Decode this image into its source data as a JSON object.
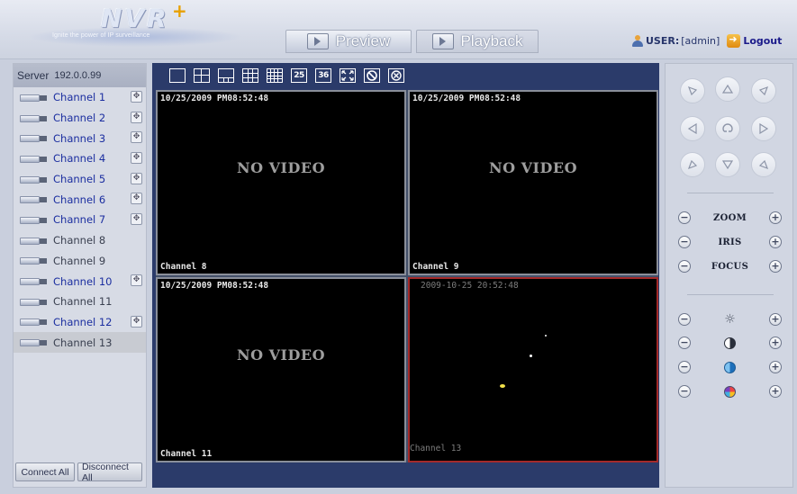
{
  "header": {
    "logo": "NVR",
    "logo_plus": "+",
    "tagline": "Ignite the power of IP surveillance",
    "tabs": [
      {
        "label": "Preview",
        "icon": "monitor-icon"
      },
      {
        "label": "Playback",
        "icon": "play-icon"
      }
    ],
    "user_label": "USER:",
    "user_name": "[admin]",
    "logout_label": "Logout"
  },
  "sidebar": {
    "server_label": "Server",
    "server_ip": "192.0.0.99",
    "channels": [
      {
        "label": "Channel 1",
        "online": true,
        "ptz": true
      },
      {
        "label": "Channel 2",
        "online": true,
        "ptz": true
      },
      {
        "label": "Channel 3",
        "online": true,
        "ptz": true
      },
      {
        "label": "Channel 4",
        "online": true,
        "ptz": true
      },
      {
        "label": "Channel 5",
        "online": true,
        "ptz": true
      },
      {
        "label": "Channel 6",
        "online": true,
        "ptz": true
      },
      {
        "label": "Channel 7",
        "online": true,
        "ptz": true
      },
      {
        "label": "Channel 8",
        "online": false,
        "ptz": false
      },
      {
        "label": "Channel 9",
        "online": false,
        "ptz": false
      },
      {
        "label": "Channel 10",
        "online": true,
        "ptz": true
      },
      {
        "label": "Channel 11",
        "online": false,
        "ptz": false
      },
      {
        "label": "Channel 12",
        "online": true,
        "ptz": true
      },
      {
        "label": "Channel 13",
        "online": false,
        "ptz": false,
        "selected": true
      }
    ],
    "connect_all_label": "Connect All",
    "disconnect_all_label": "Disconnect All"
  },
  "toolbar": {
    "layouts": [
      {
        "name": "layout-1-button",
        "icon": "layout-1-icon"
      },
      {
        "name": "layout-4-button",
        "icon": "layout-4-icon"
      },
      {
        "name": "layout-6-button",
        "icon": "layout-6-icon"
      },
      {
        "name": "layout-9-button",
        "icon": "layout-9-icon"
      },
      {
        "name": "layout-16-button",
        "icon": "layout-16-icon"
      },
      {
        "name": "layout-25-button",
        "label": "25"
      },
      {
        "name": "layout-36-button",
        "label": "36"
      },
      {
        "name": "fullscreen-button",
        "icon": "fullscreen-icon"
      },
      {
        "name": "stop-all-button",
        "icon": "stop-icon"
      },
      {
        "name": "close-all-button",
        "icon": "close-icon"
      }
    ]
  },
  "video": {
    "cells": [
      {
        "timestamp": "10/25/2009 PM08:52:48",
        "channel": "Channel 8",
        "message": "NO VIDEO",
        "active": false
      },
      {
        "timestamp": "10/25/2009 PM08:52:48",
        "channel": "Channel 9",
        "message": "NO VIDEO",
        "active": false
      },
      {
        "timestamp": "10/25/2009 PM08:52:48",
        "channel": "Channel 11",
        "message": "NO VIDEO",
        "active": false
      },
      {
        "timestamp": "2009-10-25 20:52:48",
        "channel": "Channel 13",
        "message": "",
        "active": true
      }
    ]
  },
  "ptz": {
    "arrows": [
      "up-left-arrow",
      "up-arrow",
      "up-right-arrow",
      "left-arrow",
      "auto-pan",
      "right-arrow",
      "down-left-arrow",
      "down-arrow",
      "down-right-arrow"
    ],
    "controls": [
      {
        "label": "ZOOM"
      },
      {
        "label": "IRIS"
      },
      {
        "label": "FOCUS"
      }
    ],
    "image_controls": [
      {
        "icon": "brightness-icon"
      },
      {
        "icon": "contrast-icon"
      },
      {
        "icon": "saturation-icon"
      },
      {
        "icon": "hue-icon"
      }
    ],
    "minus": "−",
    "plus": "+"
  }
}
